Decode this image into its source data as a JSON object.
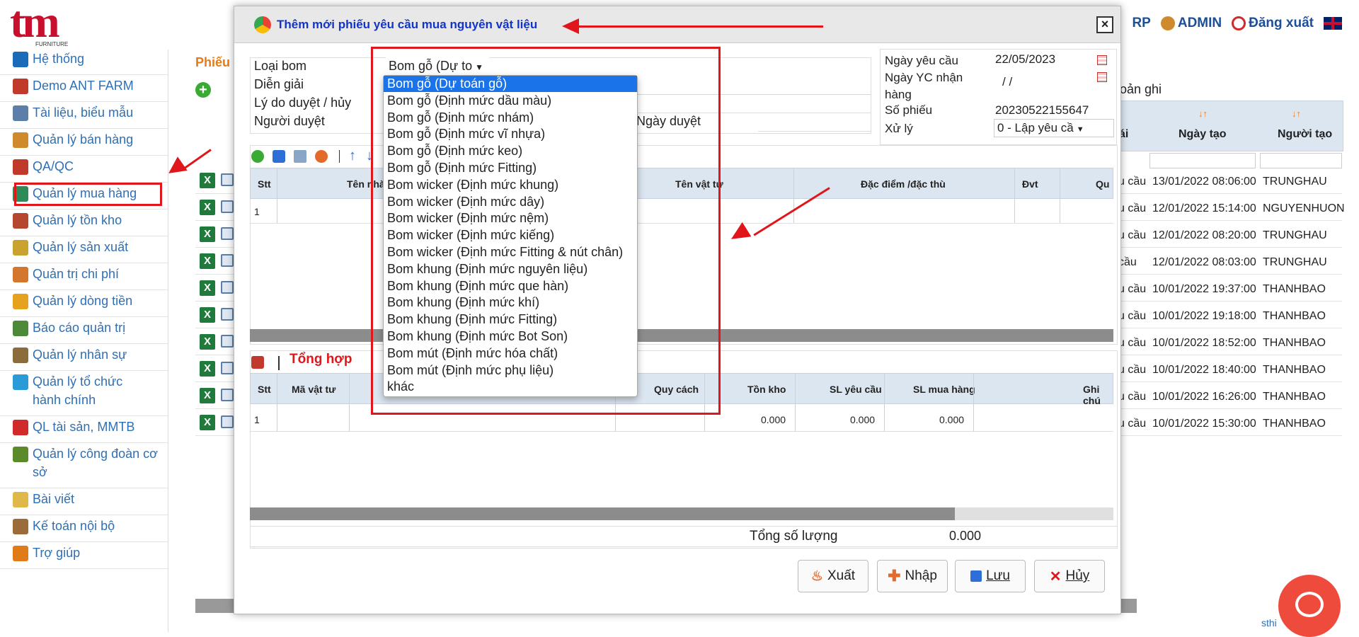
{
  "logo": {
    "brand": "tm",
    "sub": "FURNITURE"
  },
  "topnav": {
    "erp": "RP",
    "admin": "ADMIN",
    "logout": "Đăng xuất"
  },
  "sidebar": {
    "items": [
      {
        "label": "Hệ thống",
        "color": "#1a6bb8"
      },
      {
        "label": "Demo ANT FARM",
        "color": "#c0392b"
      },
      {
        "label": "Tài liệu, biểu mẫu",
        "color": "#5b7fa8"
      },
      {
        "label": "Quản lý bán hàng",
        "color": "#d08a2e"
      },
      {
        "label": "QA/QC",
        "color": "#c0392b"
      },
      {
        "label": "Quản lý mua hàng",
        "color": "#2e8b57"
      },
      {
        "label": "Quản lý tồn kho",
        "color": "#b5462f"
      },
      {
        "label": "Quản lý sản xuất",
        "color": "#caa230"
      },
      {
        "label": "Quản trị chi phí",
        "color": "#d4762c"
      },
      {
        "label": "Quản lý dòng tiền",
        "color": "#e6a21f"
      },
      {
        "label": "Báo cáo quản trị",
        "color": "#4c8a3a"
      },
      {
        "label": "Quản lý nhân sự",
        "color": "#8a6d3b"
      },
      {
        "label": "Quản lý tổ chức hành chính",
        "color": "#2a9bd6"
      },
      {
        "label": "QL tài sản, MMTB",
        "color": "#d12a2a"
      },
      {
        "label": "Quản lý công đoàn cơ sở",
        "color": "#5a8a2a"
      },
      {
        "label": "Bài viết",
        "color": "#e0b84a"
      },
      {
        "label": "Kế toán nội bộ",
        "color": "#9b6b3a"
      },
      {
        "label": "Trợ giúp",
        "color": "#e07b1a"
      }
    ]
  },
  "background": {
    "title": "Phiếu",
    "records_label": "oản ghi",
    "columns": [
      "ái",
      "Ngày tạo",
      "Người tạo"
    ],
    "rows": [
      {
        "status": "u cầu",
        "date": "13/01/2022 08:06:00",
        "user": "TRUNGHAU"
      },
      {
        "status": "u cầu",
        "date": "12/01/2022 15:14:00",
        "user": "NGUYENHUON"
      },
      {
        "status": "u cầu",
        "date": "12/01/2022 08:20:00",
        "user": "TRUNGHAU"
      },
      {
        "status": "cầu",
        "date": "12/01/2022 08:03:00",
        "user": "TRUNGHAU"
      },
      {
        "status": "u cầu",
        "date": "10/01/2022 19:37:00",
        "user": "THANHBAO"
      },
      {
        "status": "u cầu",
        "date": "10/01/2022 19:18:00",
        "user": "THANHBAO"
      },
      {
        "status": "u cầu",
        "date": "10/01/2022 18:52:00",
        "user": "THANHBAO"
      },
      {
        "status": "u cầu",
        "date": "10/01/2022 18:40:00",
        "user": "THANHBAO"
      },
      {
        "status": "u cầu",
        "date": "10/01/2022 16:26:00",
        "user": "THANHBAO"
      },
      {
        "status": "u cầu",
        "date": "10/01/2022 15:30:00",
        "user": "THANHBAO"
      }
    ],
    "footer_link": "sthi"
  },
  "modal": {
    "title": "Thêm mới phiếu yêu cầu mua nguyên vật liệu",
    "close": "×",
    "form": {
      "loai_bom_label": "Loại bom",
      "loai_bom_value": "Bom gỗ (Dự to",
      "dien_giai_label": "Diễn giải",
      "ly_do_label": "Lý do duyệt / hủy",
      "nguoi_duyet_label": "Người duyệt",
      "ngay_duyet_label": "Ngày duyệt"
    },
    "right_form": {
      "ngay_yc_label": "Ngày yêu cầu",
      "ngay_yc_value": "22/05/2023",
      "ngay_nhan_label": "Ngày YC nhận hàng",
      "ngay_nhan_value": "/ /",
      "so_phieu_label": "Số phiếu",
      "so_phieu_value": "20230522155647",
      "xu_ly_label": "Xử lý",
      "xu_ly_value": "0 - Lập yêu cầ"
    },
    "grid1": {
      "columns": [
        "Stt",
        "Tên nhà",
        "Tên vật tư",
        "Đặc điểm /đặc thù",
        "Đvt",
        "Qu"
      ],
      "row1": "1"
    },
    "summary_title": "Tổng hợp",
    "grid2": {
      "columns": [
        "Stt",
        "Mã vật tư",
        "Quy cách",
        "Tồn kho",
        "SL yêu cầu",
        "SL mua hàng",
        "Ghi chú"
      ],
      "row": {
        "stt": "1",
        "ton_kho": "0.000",
        "sl_yeu_cau": "0.000",
        "sl_mua_hang": "0.000"
      }
    },
    "total_label": "Tổng số lượng",
    "total_value": "0.000",
    "buttons": {
      "xuat": "Xuất",
      "nhap": "Nhập",
      "luu": "Lưu",
      "huy": "Hủy"
    }
  },
  "dropdown": {
    "options": [
      "Bom gỗ (Dự toán gỗ)",
      "Bom gỗ (Định mức dầu màu)",
      "Bom gỗ (Định mức nhám)",
      "Bom gỗ (Định mức vĩ nhựa)",
      "Bom gỗ (Định mức keo)",
      "Bom gỗ (Định mức Fitting)",
      "Bom wicker (Định mức khung)",
      "Bom wicker (Định mức dây)",
      "Bom wicker (Định mức nệm)",
      "Bom wicker (Định mức kiếng)",
      "Bom wicker (Định mức Fitting & nút chân)",
      "Bom khung (Định mức nguyên liệu)",
      "Bom khung (Định mức que hàn)",
      "Bom khung (Định mức khí)",
      "Bom khung (Định mức Fitting)",
      "Bom khung (Định mức Bot Son)",
      "Bom mút (Định mức hóa chất)",
      "Bom mút (Định mức phụ liệu)",
      "khác"
    ],
    "selected_index": 0
  },
  "colors": {
    "accent": "#1a73e8",
    "annotation": "#e0161b",
    "title_blue": "#1234c8",
    "brand_red": "#c8102e"
  }
}
